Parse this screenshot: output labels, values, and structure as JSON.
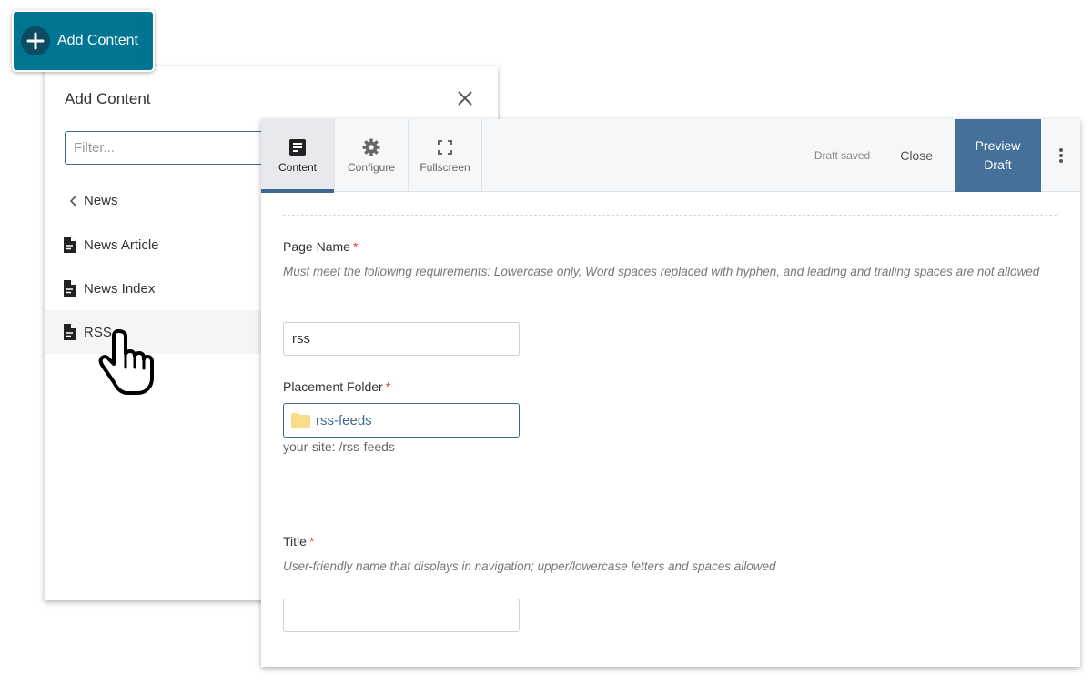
{
  "add_button": {
    "label": "Add Content",
    "icon": "plus-icon",
    "color": "#007493"
  },
  "add_panel": {
    "title": "Add Content",
    "close_icon": "close-icon",
    "filter": {
      "value": "",
      "placeholder": "Filter..."
    },
    "back": {
      "icon": "chevron-left-icon",
      "label": "News"
    },
    "items": [
      {
        "label": "News Article",
        "icon": "document-icon"
      },
      {
        "label": "News Index",
        "icon": "document-icon"
      },
      {
        "label": "RSS",
        "icon": "document-icon",
        "hovered": true
      }
    ]
  },
  "editor": {
    "tabs": [
      {
        "label": "Content",
        "icon": "document-icon",
        "active": true
      },
      {
        "label": "Configure",
        "icon": "gear-icon",
        "active": false
      },
      {
        "label": "Fullscreen",
        "icon": "fullscreen-icon",
        "active": false
      }
    ],
    "status": "Draft saved",
    "close_label": "Close",
    "preview_label_line1": "Preview",
    "preview_label_line2": "Draft",
    "preview_color": "#44709a",
    "more_icon": "kebab-menu-icon",
    "fields": {
      "page_name": {
        "label": "Page Name",
        "required": "*",
        "help": "Must meet the following requirements: Lowercase only, Word spaces replaced with hyphen, and leading and trailing spaces are not allowed",
        "value": "rss"
      },
      "placement_folder": {
        "label": "Placement Folder",
        "required": "*",
        "value": "rss-feeds",
        "icon": "folder-icon",
        "path": "your-site: /rss-feeds"
      },
      "title": {
        "label": "Title",
        "required": "*",
        "help": "User-friendly name that displays in navigation; upper/lowercase letters and spaces allowed",
        "value": ""
      }
    }
  },
  "cursor": {
    "icon": "hand-pointer-icon"
  }
}
